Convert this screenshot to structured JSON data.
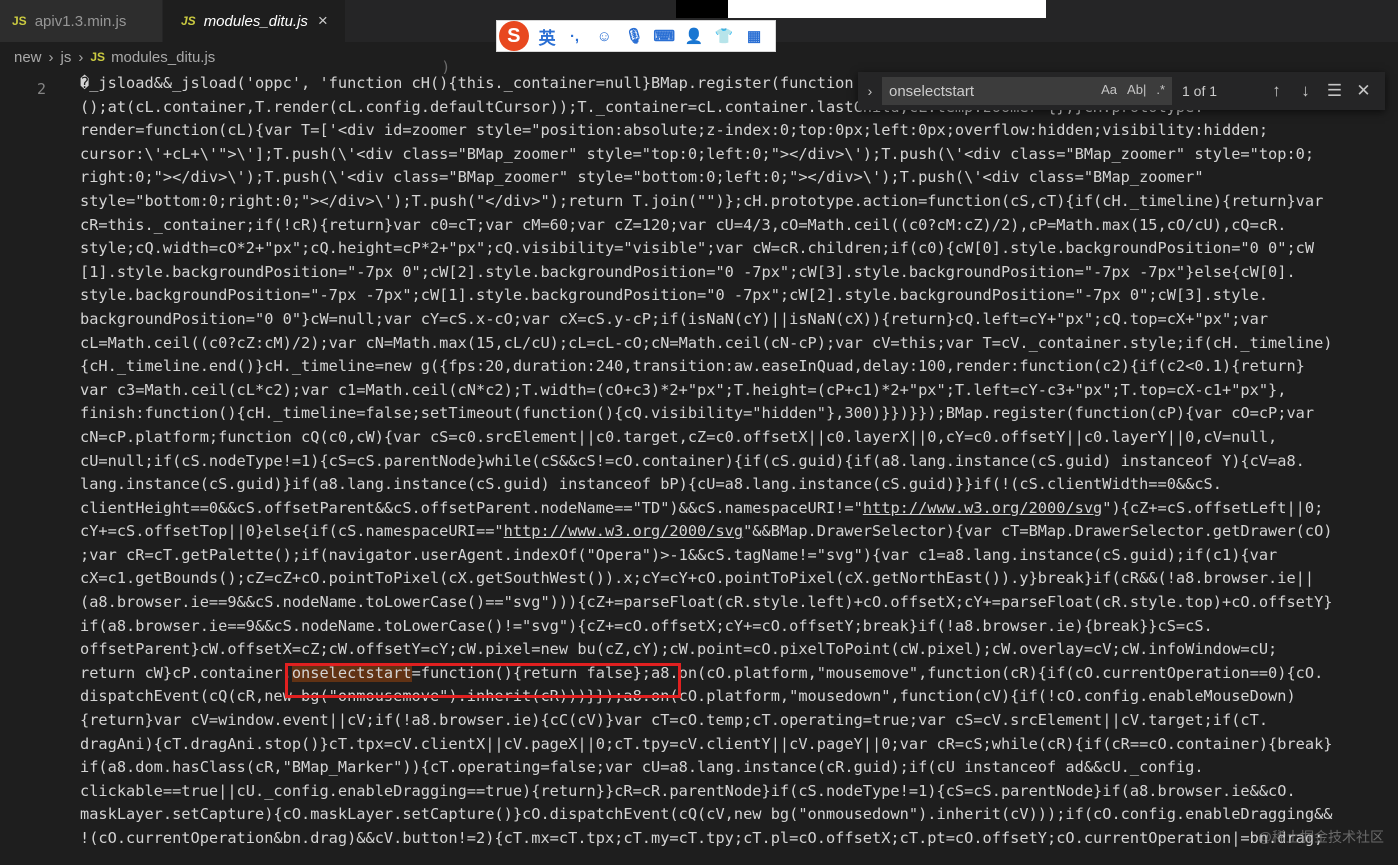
{
  "tabs": [
    {
      "icon": "JS",
      "label": "apiv1.3.min.js"
    },
    {
      "icon": "JS",
      "label": "modules_ditu.js",
      "close": "×"
    }
  ],
  "breadcrumb": [
    "new",
    "js",
    "modules_ditu.js"
  ],
  "ime": {
    "lang": "英",
    "punct": "·,"
  },
  "find": {
    "query": "onselectstart",
    "count": "1 of 1",
    "options": [
      "Aa",
      "Ab|",
      ".*"
    ]
  },
  "editor": {
    "line_number": "2",
    "ghost_text": "                                        )",
    "lines": [
      "\u0000_jsload&&_jsload('oppc', 'function cH(){this._container=null}BMap.register(function",
      "();at(cL.container,T.render(cL.config.defaultCursor));T._container=cL.container.lastChild;cL.temp.zoomer={};}cH.prototype.",
      "render=function(cL){var T=['<div id=zoomer style=\"position:absolute;z-index:0;top:0px;left:0px;overflow:hidden;visibility:hidden;",
      "cursor:\\'+cL+\\'\">\\'];T.push(\\'<div class=\"BMap_zoomer\" style=\"top:0;left:0;\"></div>\\');T.push(\\'<div class=\"BMap_zoomer\" style=\"top:0;",
      "right:0;\"></div>\\');T.push(\\'<div class=\"BMap_zoomer\" style=\"bottom:0;left:0;\"></div>\\');T.push(\\'<div class=\"BMap_zoomer\"",
      "style=\"bottom:0;right:0;\"></div>\\');T.push(\"</div>\");return T.join(\"\")};cH.prototype.action=function(cS,cT){if(cH._timeline){return}var",
      "cR=this._container;if(!cR){return}var c0=cT;var cM=60;var cZ=120;var cU=4/3,cO=Math.ceil((c0?cM:cZ)/2),cP=Math.max(15,cO/cU),cQ=cR.",
      "style;cQ.width=cO*2+\"px\";cQ.height=cP*2+\"px\";cQ.visibility=\"visible\";var cW=cR.children;if(c0){cW[0].style.backgroundPosition=\"0 0\";cW",
      "[1].style.backgroundPosition=\"-7px 0\";cW[2].style.backgroundPosition=\"0 -7px\";cW[3].style.backgroundPosition=\"-7px -7px\"}else{cW[0].",
      "style.backgroundPosition=\"-7px -7px\";cW[1].style.backgroundPosition=\"0 -7px\";cW[2].style.backgroundPosition=\"-7px 0\";cW[3].style.",
      "backgroundPosition=\"0 0\"}cW=null;var cY=cS.x-cO;var cX=cS.y-cP;if(isNaN(cY)||isNaN(cX)){return}cQ.left=cY+\"px\";cQ.top=cX+\"px\";var",
      "cL=Math.ceil((c0?cZ:cM)/2);var cN=Math.max(15,cL/cU);cL=cL-cO;cN=Math.ceil(cN-cP);var cV=this;var T=cV._container.style;if(cH._timeline)",
      "{cH._timeline.end()}cH._timeline=new g({fps:20,duration:240,transition:aw.easeInQuad,delay:100,render:function(c2){if(c2<0.1){return}",
      "var c3=Math.ceil(cL*c2);var c1=Math.ceil(cN*c2);T.width=(cO+c3)*2+\"px\";T.height=(cP+c1)*2+\"px\";T.left=cY-c3+\"px\";T.top=cX-c1+\"px\"},",
      "finish:function(){cH._timeline=false;setTimeout(function(){cQ.visibility=\"hidden\"},300)}})}});BMap.register(function(cP){var cO=cP;var",
      "cN=cP.platform;function cQ(c0,cW){var cS=c0.srcElement||c0.target,cZ=c0.offsetX||c0.layerX||0,cY=c0.offsetY||c0.layerY||0,cV=null,",
      "cU=null;if(cS.nodeType!=1){cS=cS.parentNode}while(cS&&cS!=cO.container){if(cS.guid){if(a8.lang.instance(cS.guid) instanceof Y){cV=a8.",
      "lang.instance(cS.guid)}if(a8.lang.instance(cS.guid) instanceof bP){cU=a8.lang.instance(cS.guid)}}if(!(cS.clientWidth==0&&cS.",
      "clientHeight==0&&cS.offsetParent&&cS.offsetParent.nodeName==\"TD\")&&cS.namespaceURI!=\"http://www.w3.org/2000/svg\"){cZ+=cS.offsetLeft||0;",
      "cY+=cS.offsetTop||0}else{if(cS.namespaceURI==\"http://www.w3.org/2000/svg\"&&BMap.DrawerSelector){var cT=BMap.DrawerSelector.getDrawer(cO)",
      ";var cR=cT.getPalette();if(navigator.userAgent.indexOf(\"Opera\")>-1&&cS.tagName!=\"svg\"){var c1=a8.lang.instance(cS.guid);if(c1){var",
      "cX=c1.getBounds();cZ=cZ+cO.pointToPixel(cX.getSouthWest()).x;cY=cY+cO.pointToPixel(cX.getNorthEast()).y}break}if(cR&&(!a8.browser.ie||",
      "(a8.browser.ie==9&&cS.nodeName.toLowerCase()==\"svg\"))){cZ+=parseFloat(cR.style.left)+cO.offsetX;cY+=parseFloat(cR.style.top)+cO.offsetY}",
      "if(a8.browser.ie==9&&cS.nodeName.toLowerCase()!=\"svg\"){cZ+=cO.offsetX;cY+=cO.offsetY;break}if(!a8.browser.ie){break}}cS=cS.",
      "offsetParent}cW.offsetX=cZ;cW.offsetY=cY;cW.pixel=new bu(cZ,cY);cW.point=cO.pixelToPoint(cW.pixel);cW.overlay=cV;cW.infoWindow=cU;",
      "return cW}cP.container.onselectstart=function(){return false};a8.on(cO.platform,\"mousemove\",function(cR){if(cO.currentOperation==0){cO.",
      "dispatchEvent(cQ(cR,new bg(\"onmousemove\").inherit(cR)))}});a8.on(cO.platform,\"mousedown\",function(cV){if(!cO.config.enableMouseDown)",
      "{return}var cV=window.event||cV;if(!a8.browser.ie){cC(cV)}var cT=cO.temp;cT.operating=true;var cS=cV.srcElement||cV.target;if(cT.",
      "dragAni){cT.dragAni.stop()}cT.tpx=cV.clientX||cV.pageX||0;cT.tpy=cV.clientY||cV.pageY||0;var cR=cS;while(cR){if(cR==cO.container){break}",
      "if(a8.dom.hasClass(cR,\"BMap_Marker\")){cT.operating=false;var cU=a8.lang.instance(cR.guid);if(cU instanceof ad&&cU._config.",
      "clickable==true||cU._config.enableDragging==true){return}}cR=cR.parentNode}if(cS.nodeType!=1){cS=cS.parentNode}if(a8.browser.ie&&cO.",
      "maskLayer.setCapture){cO.maskLayer.setCapture()}cO.dispatchEvent(cQ(cV,new bg(\"onmousedown\").inherit(cV)));if(cO.config.enableDragging&&",
      "!(cO.currentOperation&bn.drag)&&cV.button!=2){cT.mx=cT.tpx;cT.my=cT.tpy;cT.pl=cO.offsetX;cT.pt=cO.offsetY;cO.currentOperation|=bn.drag;"
    ],
    "highlight_term": "onselectstart",
    "link_text": "http://www.w3.org/2000/svg"
  },
  "watermark": "@稀土掘金技术社区"
}
